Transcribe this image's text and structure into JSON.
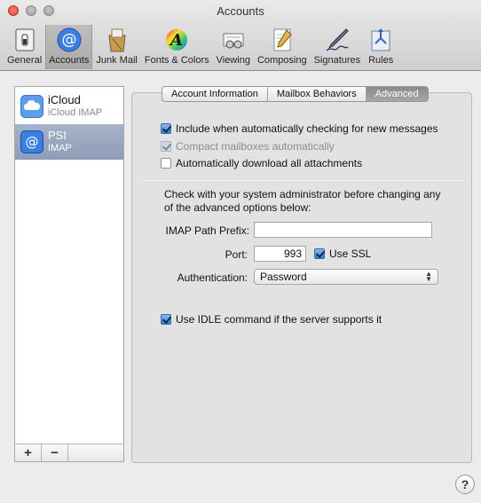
{
  "window": {
    "title": "Accounts"
  },
  "toolbar": {
    "items": [
      {
        "label": "General",
        "icon": "switch-icon"
      },
      {
        "label": "Accounts",
        "icon": "at-sign-icon",
        "selected": true
      },
      {
        "label": "Junk Mail",
        "icon": "junk-mail-icon"
      },
      {
        "label": "Fonts & Colors",
        "icon": "fonts-colors-icon"
      },
      {
        "label": "Viewing",
        "icon": "viewing-icon"
      },
      {
        "label": "Composing",
        "icon": "composing-icon"
      },
      {
        "label": "Signatures",
        "icon": "signature-pen-icon"
      },
      {
        "label": "Rules",
        "icon": "rules-icon"
      }
    ]
  },
  "sidebar": {
    "accounts": [
      {
        "name": "iCloud",
        "type": "iCloud IMAP",
        "icon": "icloud-icon"
      },
      {
        "name": "PSI",
        "type": "IMAP",
        "icon": "at-sign-icon",
        "selected": true
      }
    ],
    "add_label": "+",
    "remove_label": "−"
  },
  "tabs": [
    {
      "label": "Account Information"
    },
    {
      "label": "Mailbox Behaviors"
    },
    {
      "label": "Advanced",
      "active": true
    }
  ],
  "advanced": {
    "include_auto_check": {
      "label": "Include when automatically checking for new messages",
      "checked": true
    },
    "compact_mailboxes": {
      "label": "Compact mailboxes automatically",
      "checked": true,
      "disabled": true
    },
    "download_attachments": {
      "label": "Automatically download all attachments",
      "checked": false
    },
    "note": "Check with your system administrator before changing any of the advanced options below:",
    "imap_prefix_label": "IMAP Path Prefix:",
    "imap_prefix_value": "",
    "port_label": "Port:",
    "port_value": "993",
    "use_ssl": {
      "label": "Use SSL",
      "checked": true
    },
    "auth_label": "Authentication:",
    "auth_value": "Password",
    "use_idle": {
      "label": "Use IDLE command if the server supports it",
      "checked": true
    }
  },
  "help_label": "?",
  "colors": {
    "selection": "#8e9cb8",
    "checkbox_on": "#3f7ac9",
    "accent_blue": "#2f6fd6"
  }
}
